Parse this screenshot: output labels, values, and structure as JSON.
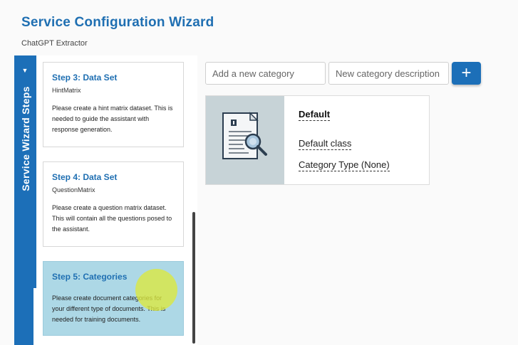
{
  "header": {
    "title": "Service Configuration Wizard",
    "subtitle": "ChatGPT Extractor"
  },
  "rail": {
    "label": "Service Wizard Steps",
    "arrow": "▼"
  },
  "steps": [
    {
      "title": "Step 3: Data Set",
      "subtitle": "HintMatrix",
      "description": "Please create a hint matrix dataset. This is needed to guide the assistant with response generation.",
      "active": false
    },
    {
      "title": "Step 4: Data Set",
      "subtitle": "QuestionMatrix",
      "description": "Please create a question matrix dataset. This will contain all the questions posed to the assistant.",
      "active": false
    },
    {
      "title": "Step 5: Categories",
      "subtitle": "",
      "description": "Please create document categories for your different type of documents. This is needed for training documents.",
      "active": true
    }
  ],
  "category_form": {
    "name_placeholder": "Add a new category",
    "description_placeholder": "New category description",
    "add_button_label": "+"
  },
  "categories": [
    {
      "name": "Default",
      "class": "Default class",
      "type": "Category Type (None)",
      "icon": "document-search-icon"
    }
  ],
  "colors": {
    "accent": "#1c6fb8",
    "title": "#1f6fb2",
    "active_step": "#add8e6",
    "thumb_bg": "#c7d3d7"
  }
}
